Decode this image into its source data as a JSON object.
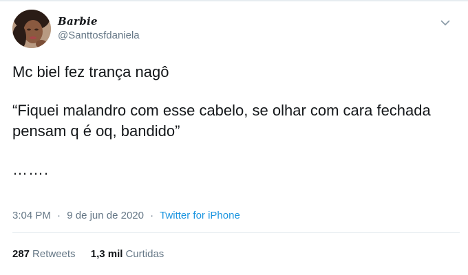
{
  "author": {
    "display_name": "Barbie",
    "handle": "@Santtosfdaniela"
  },
  "tweet": {
    "paragraphs": [
      "Mc biel fez trança nagô",
      "“Fiquei malandro com esse cabelo, se olhar com cara fechada pensam q é oq, bandido”",
      "……."
    ]
  },
  "meta": {
    "time": "3:04 PM",
    "separator": "·",
    "date": "9 de jun de 2020",
    "source": "Twitter for iPhone"
  },
  "stats": {
    "retweets_count": "287",
    "retweets_label": "Retweets",
    "likes_count": "1,3 mil",
    "likes_label": "Curtidas"
  },
  "icons": {
    "menu_caret": "chevron-down-icon"
  },
  "colors": {
    "text": "#14171a",
    "secondary": "#657786",
    "link": "#1b95e0",
    "divider": "#e6ecf0"
  }
}
